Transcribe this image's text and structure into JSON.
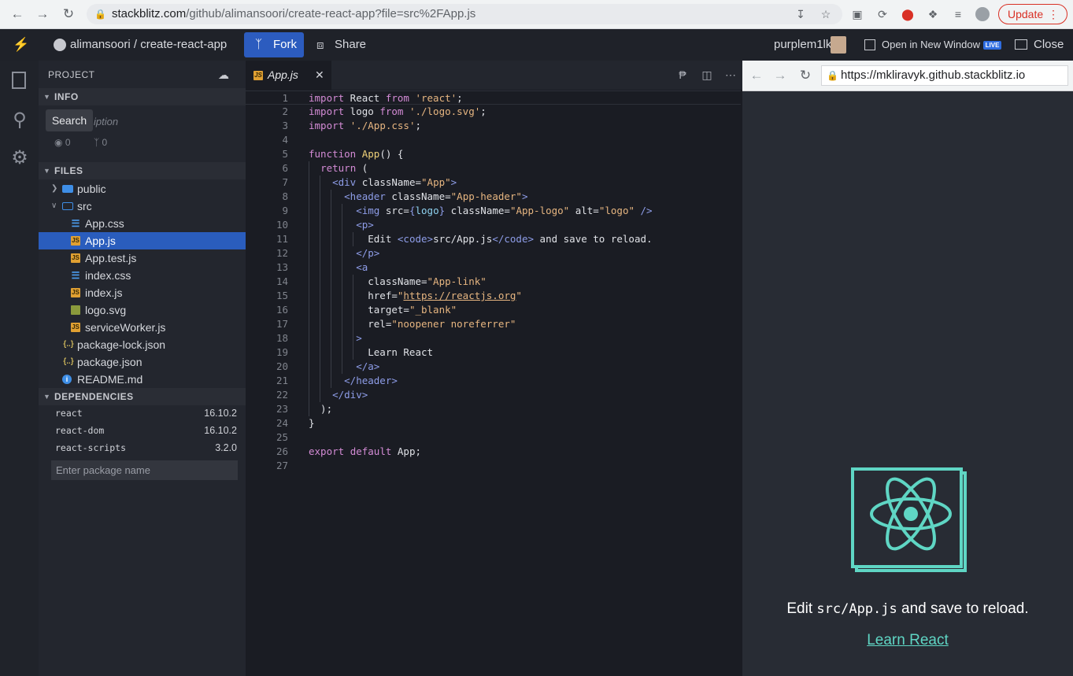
{
  "browser": {
    "url_host": "stackblitz.com",
    "url_path": "/github/alimansoori/create-react-app?file=src%2FApp.js",
    "update_label": "Update"
  },
  "header": {
    "repo": "alimansoori / create-react-app",
    "fork_label": "Fork",
    "share_label": "Share",
    "username": "purplem1lk",
    "open_window_label": "Open in New Window",
    "live_badge": "LIVE",
    "close_label": "Close"
  },
  "activity": {
    "tooltip": "Search"
  },
  "sidebar": {
    "project_label": "PROJECT",
    "info_label": "INFO",
    "description_placeholder": "iption",
    "views": "0",
    "forks": "0",
    "files_label": "FILES",
    "files": [
      {
        "name": "public",
        "kind": "folder-closed",
        "depth": 0
      },
      {
        "name": "src",
        "kind": "folder-open",
        "depth": 0
      },
      {
        "name": "App.css",
        "kind": "css",
        "depth": 1
      },
      {
        "name": "App.js",
        "kind": "js",
        "depth": 1,
        "selected": true
      },
      {
        "name": "App.test.js",
        "kind": "js",
        "depth": 1
      },
      {
        "name": "index.css",
        "kind": "css",
        "depth": 1
      },
      {
        "name": "index.js",
        "kind": "js",
        "depth": 1
      },
      {
        "name": "logo.svg",
        "kind": "svg",
        "depth": 1
      },
      {
        "name": "serviceWorker.js",
        "kind": "js",
        "depth": 1
      },
      {
        "name": "package-lock.json",
        "kind": "json",
        "depth": 0
      },
      {
        "name": "package.json",
        "kind": "json",
        "depth": 0
      },
      {
        "name": "README.md",
        "kind": "info",
        "depth": 0
      }
    ],
    "dependencies_label": "DEPENDENCIES",
    "dependencies": [
      {
        "name": "react",
        "version": "16.10.2"
      },
      {
        "name": "react-dom",
        "version": "16.10.2"
      },
      {
        "name": "react-scripts",
        "version": "3.2.0"
      }
    ],
    "package_placeholder": "Enter package name"
  },
  "editor": {
    "tab_name": "App.js",
    "current_line": 1,
    "lines": [
      "import React from 'react';",
      "import logo from './logo.svg';",
      "import './App.css';",
      "",
      "function App() {",
      "  return (",
      "    <div className=\"App\">",
      "      <header className=\"App-header\">",
      "        <img src={logo} className=\"App-logo\" alt=\"logo\" />",
      "        <p>",
      "          Edit <code>src/App.js</code> and save to reload.",
      "        </p>",
      "        <a",
      "          className=\"App-link\"",
      "          href=\"https://reactjs.org\"",
      "          target=\"_blank\"",
      "          rel=\"noopener noreferrer\"",
      "        >",
      "          Learn React",
      "        </a>",
      "      </header>",
      "    </div>",
      "  );",
      "}",
      "",
      "export default App;",
      ""
    ]
  },
  "preview": {
    "url": "https://mkliravyk.github.stackblitz.io",
    "text_before": "Edit ",
    "text_code": "src/App.js",
    "text_after": " and save to reload.",
    "link": "Learn React",
    "accent": "#5fd6c4"
  }
}
